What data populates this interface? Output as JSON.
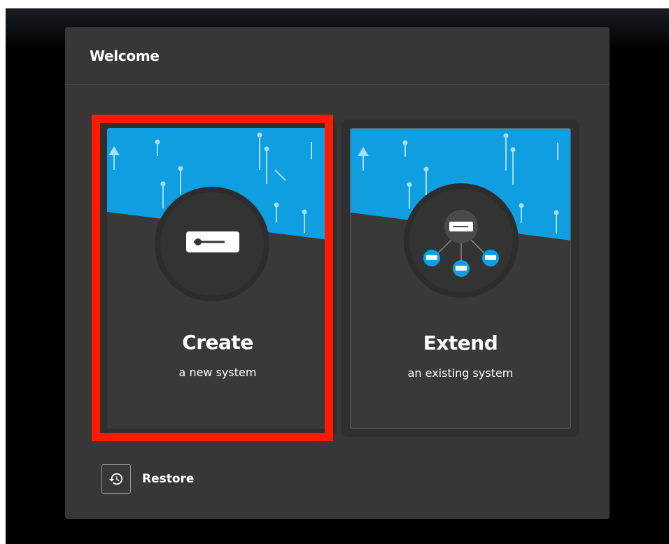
{
  "dialog": {
    "title": "Welcome"
  },
  "cards": [
    {
      "title": "Create",
      "subtitle": "a new system",
      "selected": true
    },
    {
      "title": "Extend",
      "subtitle": "an existing system",
      "selected": false
    }
  ],
  "restore": {
    "label": "Restore"
  },
  "colors": {
    "accent_blue": "#0f9ee0",
    "dialog_bg": "#373737",
    "card_bg": "#393939",
    "highlight_red": "#ff1a00"
  },
  "icons": {
    "create": "server-icon",
    "extend": "network-servers-icon",
    "restore": "history-icon"
  }
}
